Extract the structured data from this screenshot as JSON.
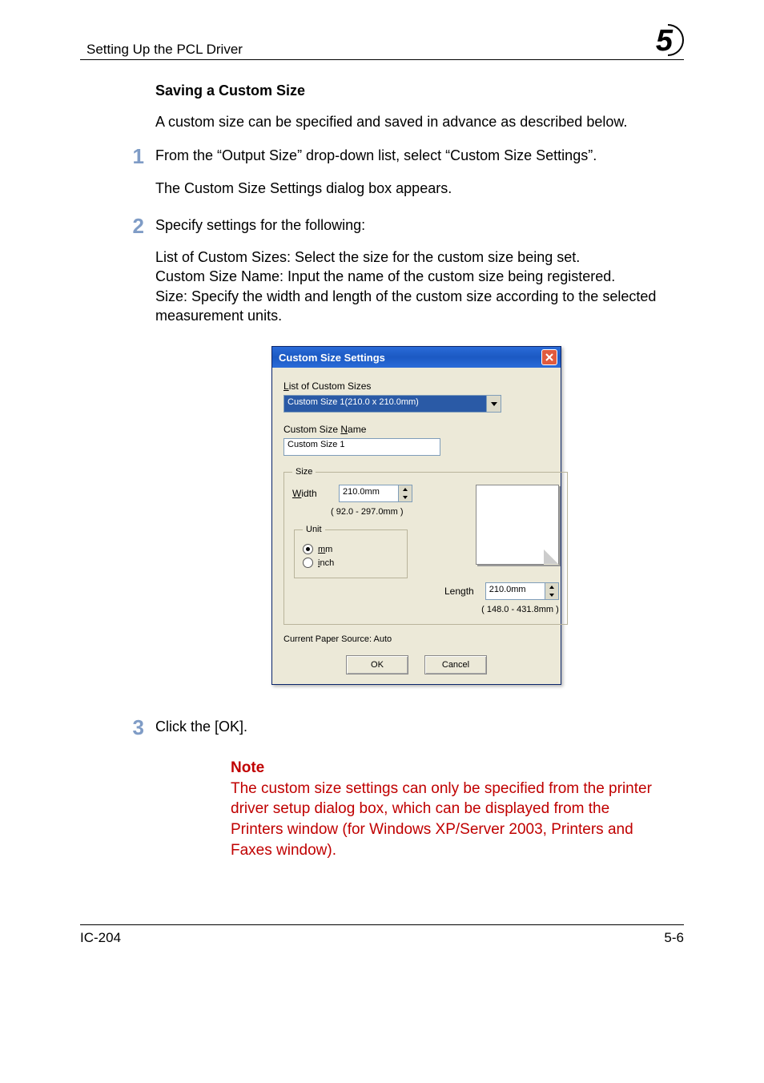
{
  "header": {
    "section_title": "Setting Up the PCL Driver",
    "chapter_number": "5"
  },
  "section": {
    "heading": "Saving a Custom Size",
    "intro": "A custom size can be specified and saved in advance as described below."
  },
  "steps": {
    "s1": {
      "num": "1",
      "p1": "From the “Output Size” drop-down list, select “Custom Size Settings”.",
      "p2": "The Custom Size Settings dialog box appears."
    },
    "s2": {
      "num": "2",
      "p1": "Specify settings for the following:",
      "p2": "List of Custom Sizes: Select the size for the custom size being set.",
      "p3": "Custom Size Name: Input the name of the custom size being registered.",
      "p4": "Size: Specify the width and length of the custom size according to the selected measurement units."
    },
    "s3": {
      "num": "3",
      "p1": "Click the [OK]."
    }
  },
  "dialog": {
    "title": "Custom Size Settings",
    "list_label_pre": "L",
    "list_label_post": "ist of Custom Sizes",
    "list_value": "Custom Size 1(210.0 x 210.0mm)",
    "name_label_pre": "Custom Size ",
    "name_label_u": "N",
    "name_label_post": "ame",
    "name_value": "Custom Size 1",
    "size_legend": "Size",
    "width_label_u": "W",
    "width_label_post": "idth",
    "width_value": "210.0mm",
    "width_range": "( 92.0 - 297.0mm )",
    "unit_legend": "Unit",
    "unit_mm_u": "m",
    "unit_mm_post": "m",
    "unit_inch_u": "i",
    "unit_inch_post": "nch",
    "length_label_pre": "Len",
    "length_label_u": "g",
    "length_label_post": "th",
    "length_value": "210.0mm",
    "length_range": "( 148.0 - 431.8mm )",
    "paper_source": "Current Paper Source: Auto",
    "ok": "OK",
    "cancel": "Cancel"
  },
  "note": {
    "title": "Note",
    "text": "The custom size settings can only be specified from the printer driver setup dialog box, which can be displayed from the Printers window (for Windows XP/Server 2003, Printers and Faxes window)."
  },
  "footer": {
    "left": "IC-204",
    "right": "5-6"
  }
}
